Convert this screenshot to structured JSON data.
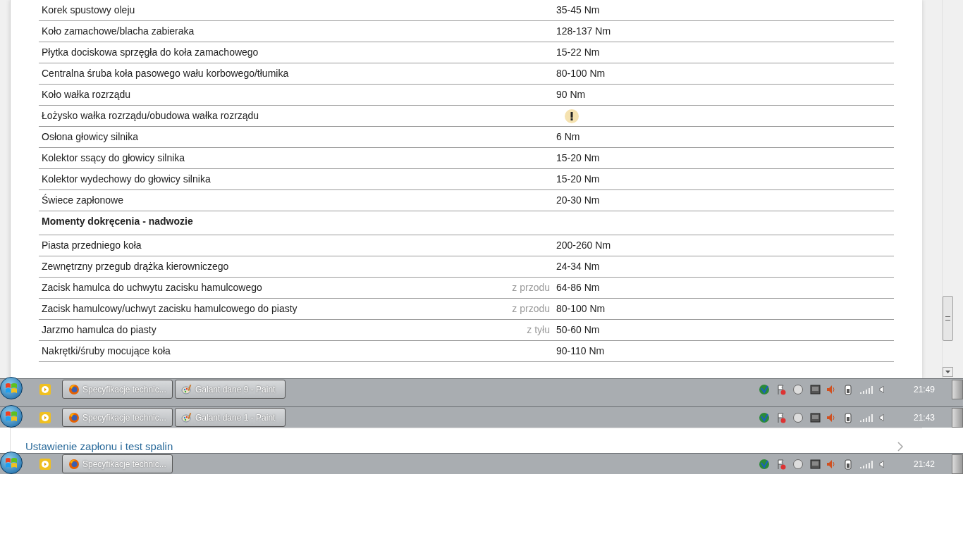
{
  "torque_table": {
    "rows": [
      {
        "kind": "row",
        "part": "Korek spustowy oleju",
        "value": "35-45 Nm",
        "warning": false
      },
      {
        "kind": "row",
        "part": "Koło zamachowe/blacha zabieraka",
        "value": "128-137 Nm",
        "warning": false
      },
      {
        "kind": "row",
        "part": "Płytka dociskowa sprzęgła do koła zamachowego",
        "value": "15-22 Nm",
        "warning": false
      },
      {
        "kind": "row",
        "part": "Centralna śruba koła pasowego wału korbowego/tłumika",
        "value": "80-100 Nm",
        "warning": false
      },
      {
        "kind": "row",
        "part": "Koło wałka rozrządu",
        "value": "90 Nm",
        "warning": false
      },
      {
        "kind": "row",
        "part": "Łożysko wałka rozrządu/obudowa wałka rozrządu",
        "warning": true
      },
      {
        "kind": "row",
        "part": "Osłona głowicy silnika",
        "value": "6 Nm",
        "warning": false
      },
      {
        "kind": "row",
        "part": "Kolektor ssący do głowicy silnika",
        "value": "15-20 Nm",
        "warning": false
      },
      {
        "kind": "row",
        "part": "Kolektor wydechowy do głowicy silnika",
        "value": "15-20 Nm",
        "warning": false
      },
      {
        "kind": "row",
        "part": "Świece zapłonowe",
        "value": "20-30 Nm",
        "warning": false
      },
      {
        "kind": "heading",
        "part": "Momenty dokręcenia - nadwozie"
      },
      {
        "kind": "row",
        "part": "Piasta przedniego koła",
        "value": "200-260 Nm",
        "warning": false
      },
      {
        "kind": "row",
        "part": "Zewnętrzny przegub drążka kierowniczego",
        "value": "24-34 Nm",
        "warning": false
      },
      {
        "kind": "row",
        "part": "Zacisk hamulca do uchwytu zacisku hamulcowego",
        "note": "z przodu",
        "value": "64-86 Nm",
        "warning": false
      },
      {
        "kind": "row",
        "part": "Zacisk hamulcowy/uchwyt zacisku hamulcowego do piasty",
        "note": "z przodu",
        "value": "80-100 Nm",
        "warning": false
      },
      {
        "kind": "row",
        "part": "Jarzmo hamulca do piasty",
        "note": "z tyłu",
        "value": "50-60 Nm",
        "warning": false
      },
      {
        "kind": "row",
        "part": "Nakrętki/śruby mocujące koła",
        "value": "90-110 Nm",
        "warning": false
      }
    ]
  },
  "taskbars": [
    {
      "buttons": [
        {
          "kind": "browser",
          "label": "Specyfikacje technic..."
        },
        {
          "kind": "paint",
          "label": "Galant dane 9 - Paint"
        }
      ],
      "time": "21:49"
    },
    {
      "buttons": [
        {
          "kind": "browser",
          "label": "Specyfikacje technic..."
        },
        {
          "kind": "paint",
          "label": "Galant dane 1 - Paint"
        }
      ],
      "time": "21:43"
    },
    {
      "buttons": [
        {
          "kind": "browser",
          "label": "Specyfikacje technic..."
        }
      ],
      "time": "21:42"
    }
  ],
  "section_link": {
    "label": "Ustawienie zapłonu i test spalin"
  }
}
